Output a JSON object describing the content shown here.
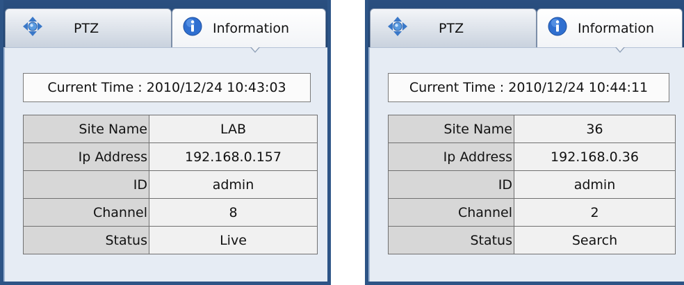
{
  "panels": [
    {
      "tabs": {
        "ptz_label": "PTZ",
        "info_label": "Information"
      },
      "current_time": "Current Time : 2010/12/24 10:43:03",
      "rows": [
        {
          "label": "Site Name",
          "value": "LAB"
        },
        {
          "label": "Ip Address",
          "value": "192.168.0.157"
        },
        {
          "label": "ID",
          "value": "admin"
        },
        {
          "label": "Channel",
          "value": "8"
        },
        {
          "label": "Status",
          "value": "Live"
        }
      ]
    },
    {
      "tabs": {
        "ptz_label": "PTZ",
        "info_label": "Information"
      },
      "current_time": "Current Time : 2010/12/24 10:44:11",
      "rows": [
        {
          "label": "Site Name",
          "value": "36"
        },
        {
          "label": "Ip Address",
          "value": "192.168.0.36"
        },
        {
          "label": "ID",
          "value": "admin"
        },
        {
          "label": "Channel",
          "value": "2"
        },
        {
          "label": "Status",
          "value": "Search"
        }
      ]
    }
  ],
  "icons": {
    "ptz": "move-arrows-icon",
    "info": "info-icon"
  },
  "colors": {
    "frame": "#2d5486",
    "panel_bg": "#e6ecf4",
    "label_cell": "#d7d7d7",
    "value_cell": "#f1f1f1"
  }
}
